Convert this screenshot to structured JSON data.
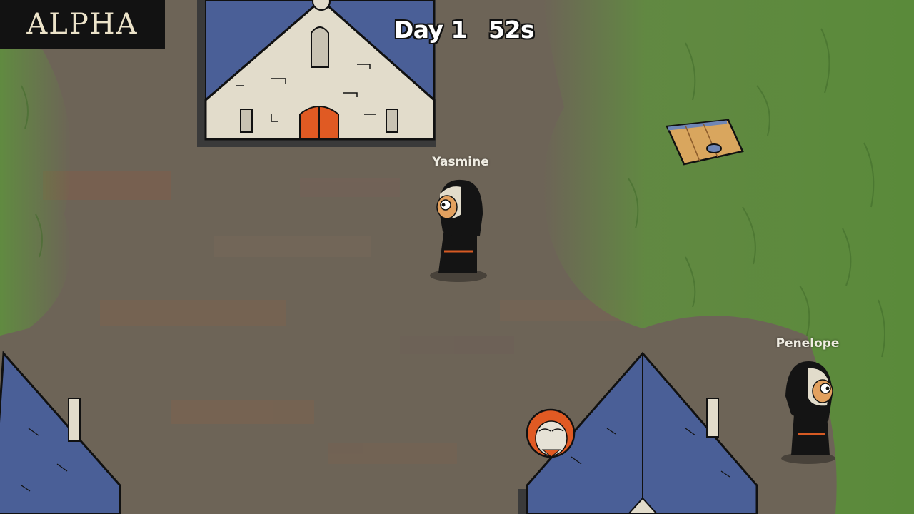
{
  "badge": {
    "label": "ALPHA"
  },
  "hud": {
    "day_label": "Day 1",
    "timer_label": "52s"
  },
  "characters": [
    {
      "name": "Yasmine",
      "role": "nun"
    },
    {
      "name": "Penelope",
      "role": "nun"
    },
    {
      "name": "",
      "role": "hooded-elder"
    }
  ],
  "colors": {
    "ground": "#6b6355",
    "grass": "#5f8f3e",
    "roof": "#4a5f97",
    "wall": "#e2dccb",
    "door": "#e05a23",
    "habit": "#141414",
    "trapdoor": "#d9a65e"
  }
}
